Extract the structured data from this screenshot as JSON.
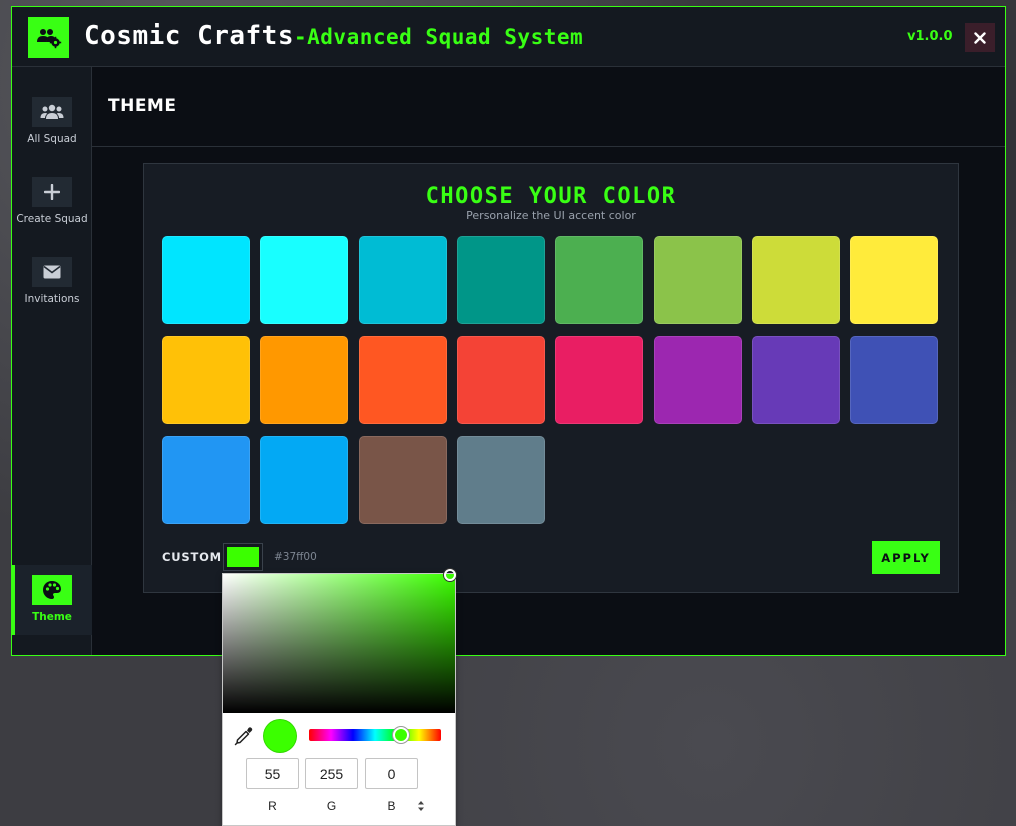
{
  "titlebar": {
    "title_main": "Cosmic Crafts",
    "title_sub": "-Advanced Squad System",
    "version": "v1.0.0",
    "close_label": "✕",
    "logo_icon": "squad-gear-icon"
  },
  "sidebar": {
    "items": [
      {
        "label": "All Squad",
        "icon": "users-icon"
      },
      {
        "label": "Create Squad",
        "icon": "plus-icon"
      },
      {
        "label": "Invitations",
        "icon": "envelope-icon"
      }
    ],
    "active": {
      "label": "Theme",
      "icon": "palette-icon"
    }
  },
  "page": {
    "title": "THEME"
  },
  "theme_panel": {
    "title": "CHOOSE YOUR COLOR",
    "subtitle": "Personalize the UI accent color",
    "swatches": [
      "#00e5ff",
      "#18ffff",
      "#00bcd4",
      "#009688",
      "#4caf50",
      "#8bc34a",
      "#cddc39",
      "#ffeb3b",
      "#ffc107",
      "#ff9800",
      "#ff5722",
      "#f44336",
      "#e91e63",
      "#9c27b0",
      "#673ab7",
      "#3f51b5",
      "#2196f3",
      "#03a9f4",
      "#795548",
      "#607d8b"
    ],
    "custom_label": "CUSTOM",
    "custom_hex": "#37ff00",
    "apply_label": "APPLY"
  },
  "picker": {
    "current_color": "#3bff00",
    "r": "55",
    "g": "255",
    "b": "0",
    "label_r": "R",
    "label_g": "G",
    "label_b": "B",
    "toggle_glyph": "⬍"
  },
  "colors": {
    "accent": "#39ff14",
    "window_bg": "#0b0e14",
    "panel_bg": "#171c24"
  }
}
